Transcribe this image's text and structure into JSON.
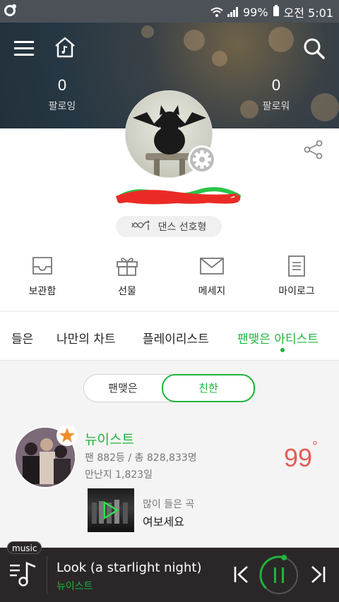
{
  "status_bar": {
    "battery": "99%",
    "time": "오전 5:01"
  },
  "stats": {
    "following_count": "0",
    "following_label": "팔로잉",
    "followers_count": "0",
    "followers_label": "팔로워"
  },
  "profile": {
    "genre": "댄스 선호형"
  },
  "actions": [
    {
      "label": "보관함",
      "icon": "inbox-icon"
    },
    {
      "label": "선물",
      "icon": "gift-icon"
    },
    {
      "label": "메세지",
      "icon": "mail-icon"
    },
    {
      "label": "마이로그",
      "icon": "document-icon"
    }
  ],
  "tabs": [
    {
      "label": "들은"
    },
    {
      "label": "나만의 차트"
    },
    {
      "label": "플레이리스트"
    },
    {
      "label": "팬맺은 아티스트",
      "active": true
    }
  ],
  "toggle": {
    "left": "팬맺은",
    "right": "친한",
    "selected": "친한"
  },
  "artist": {
    "name": "뉴이스트",
    "rank_line": "팬 882등 / 총 828,833명",
    "days_line": "만난지 1,823일",
    "score": "99",
    "score_unit": "°",
    "most_played_label": "많이 들은 곡",
    "most_played_song": "여보세요"
  },
  "player": {
    "badge": "music",
    "title": "Look (a starlight night)",
    "artist": "뉴이스트",
    "progress": 0.42
  },
  "colors": {
    "accent": "#1fb43c",
    "score": "#e45b55",
    "player_bg": "#2b2729"
  }
}
